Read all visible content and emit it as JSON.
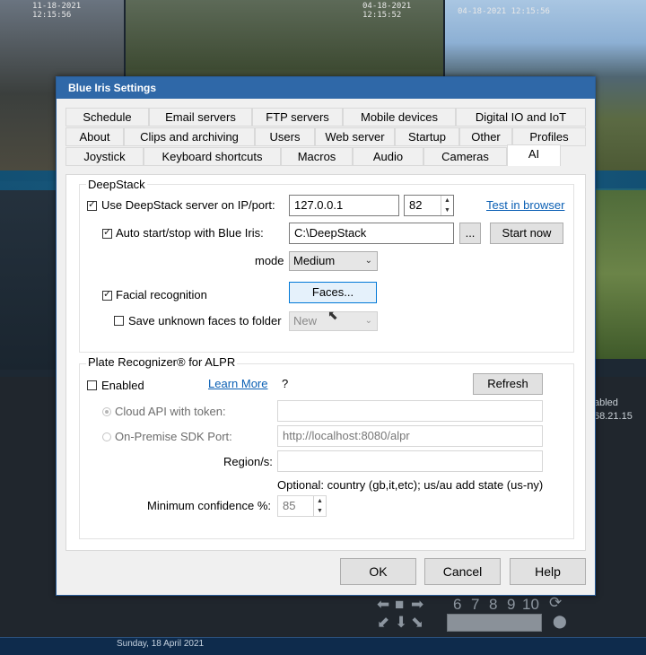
{
  "background": {
    "cameras": [
      {
        "timestamp": "11-18-2021 12:15:56"
      },
      {
        "timestamp": "04-18-2021 12:15:52"
      },
      {
        "timestamp": "04-18-2021 12:15:56"
      }
    ],
    "status_lines": [
      "abled",
      "68.21.15"
    ],
    "control_numbers": [
      "6",
      "7",
      "8",
      "9",
      "10"
    ],
    "timeline": {
      "date": "Sunday, 18 April 2021"
    }
  },
  "dialog": {
    "title": "Blue Iris Settings",
    "tabs": [
      {
        "label": "Schedule"
      },
      {
        "label": "Email servers"
      },
      {
        "label": "FTP servers"
      },
      {
        "label": "Mobile devices"
      },
      {
        "label": "Digital IO and IoT"
      },
      {
        "label": "About"
      },
      {
        "label": "Clips and archiving"
      },
      {
        "label": "Users"
      },
      {
        "label": "Web server"
      },
      {
        "label": "Startup"
      },
      {
        "label": "Other"
      },
      {
        "label": "Profiles"
      },
      {
        "label": "Joystick"
      },
      {
        "label": "Keyboard shortcuts"
      },
      {
        "label": "Macros"
      },
      {
        "label": "Audio"
      },
      {
        "label": "Cameras"
      },
      {
        "label": "AI"
      }
    ],
    "active_tab": "AI",
    "deepstack": {
      "group_title": "DeepStack",
      "use_server_label": "Use DeepStack server on IP/port:",
      "use_server_checked": true,
      "ip": "127.0.0.1",
      "port": "82",
      "test_link": "Test in browser",
      "auto_start_label": "Auto start/stop with Blue Iris:",
      "auto_start_checked": true,
      "path": "C:\\DeepStack",
      "browse_label": "...",
      "start_now_label": "Start now",
      "mode_label": "mode",
      "mode_value": "Medium",
      "facial_label": "Facial recognition",
      "facial_checked": true,
      "faces_button": "Faces...",
      "save_unknown_label": "Save unknown faces to folder",
      "save_unknown_checked": false,
      "folder_value": "New"
    },
    "alpr": {
      "group_title": "Plate Recognizer® for ALPR",
      "enabled_label": "Enabled",
      "enabled_checked": false,
      "learn_more": "Learn More",
      "help_q": "?",
      "refresh_label": "Refresh",
      "cloud_api_label": "Cloud API with token:",
      "cloud_api_selected": true,
      "cloud_token_value": "",
      "onprem_label": "On-Premise SDK Port:",
      "onprem_value": "http://localhost:8080/alpr",
      "region_label": "Region/s:",
      "region_value": "",
      "region_hint": "Optional: country (gb,it,etc); us/au add state (us-ny)",
      "min_conf_label": "Minimum confidence %:",
      "min_conf_value": "85"
    },
    "buttons": {
      "ok": "OK",
      "cancel": "Cancel",
      "help": "Help"
    }
  }
}
